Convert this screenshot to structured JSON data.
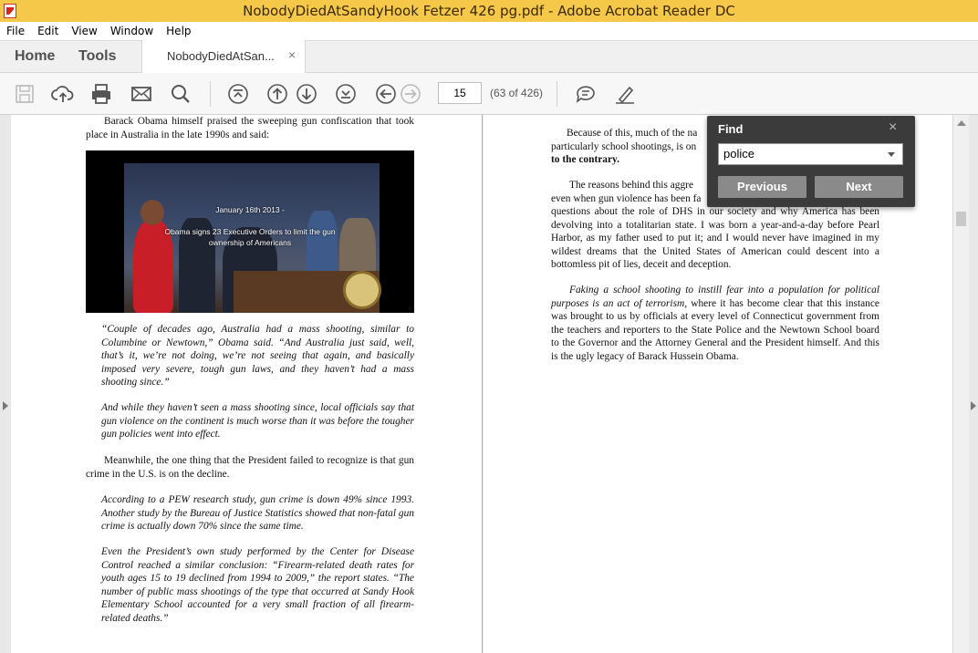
{
  "window": {
    "title": "NobodyDiedAtSandyHook Fetzer 426 pg.pdf - Adobe Acrobat Reader DC"
  },
  "menu": [
    "File",
    "Edit",
    "View",
    "Window",
    "Help"
  ],
  "tabs": {
    "home": "Home",
    "tools": "Tools",
    "document": "NobodyDiedAtSan...",
    "close_glyph": "×"
  },
  "toolbar": {
    "page_number": "15",
    "page_count": "(63 of 426)"
  },
  "find": {
    "title": "Find",
    "close_glyph": "×",
    "query": "police",
    "previous_label": "Previous",
    "next_label": "Next"
  },
  "left_page": {
    "p1": "Barack Obama himself praised the sweeping gun confiscation that took place in Australia in the late 1990s and said:",
    "photo_caption_1": "January 16th 2013 -",
    "photo_caption_2": "Obama signs 23 Executive Orders to limit the gun",
    "photo_caption_3": "ownership of Americans",
    "q1": "“Couple of decades ago, Australia had a mass shooting, similar to Columbine or Newtown,” Obama said. “And Australia just said, well, that’s it, we’re not doing, we’re not seeing that again, and basically imposed very severe, tough gun laws, and they haven’t had a mass shooting since.”",
    "q2": "And while they haven’t seen a mass shooting since, local officials say that gun violence on the continent is much worse than it was before the tougher gun policies went into effect.",
    "p2": "Meanwhile, the one thing that the President failed to recognize is that gun crime in the U.S. is on the decline.",
    "q3": "According to a PEW research study, gun crime is down 49% since 1993. Another study by the Bureau of Justice Statistics showed that non-fatal gun crime is actually down 70% since the same time.",
    "q4": "Even the President’s own study performed by the Center for Disease Control reached a similar conclusion: “Firearm-related death rates for youth ages 15 to 19 declined from 1994 to 2009,” the report states. “The number of public mass shootings of the type that occurred at Sandy Hook Elementary School accounted for a very small fraction of all firearm-related deaths.”"
  },
  "right_page": {
    "p1_start": "Because of this, much of the na",
    "p1_line2": "particularly school shootings, is on",
    "p1_bold": "to the contrary.",
    "p2_line1": "The reasons behind this aggre",
    "p2_line2": "even when gun violence has been fa",
    "p2_rest": "questions about the role of DHS in our society and why America has been devolving into a totalitarian state. I was born a year-and-a-day before Pearl Harbor, as my father used to put it; and I would never have imagined in my wildest dreams that the United States of American could descent into a bottomless pit of lies, deceit and deception.",
    "p3_italic": "Faking a school shooting to instill fear into a population for political purposes is an act of terrorism,",
    "p3_rest": " where it has become clear that this instance was brought to us by officials at every level of Connecticut government from the teachers and reporters to the State Police and the Newtown School board to the Governor and the Attorney General and the President himself. And this is the ugly legacy of Barack Hussein Obama."
  }
}
